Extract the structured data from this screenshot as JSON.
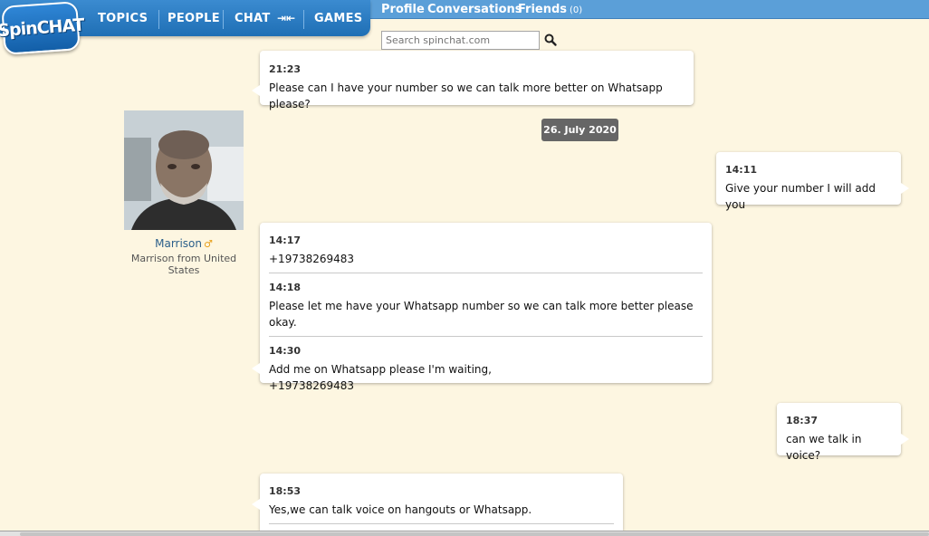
{
  "logo": {
    "text": "SpinCHAT"
  },
  "nav": {
    "topics": "TOPICS",
    "people": "PEOPLE",
    "chat": "CHAT",
    "chat_arrows": "⇥⇤",
    "games": "GAMES"
  },
  "top_links": {
    "profile": "Profile",
    "conversations": "Conversations",
    "friends": "Friends",
    "friends_count": "(0)"
  },
  "search": {
    "placeholder": "Search spinchat.com"
  },
  "profile": {
    "name": "Marrison",
    "gender_symbol": "♂",
    "location": "Marrison from United States"
  },
  "date_separator": "26. July 2020",
  "messages": [
    {
      "side": "left",
      "items": [
        {
          "time": "21:23",
          "text": "Please can I have your number so we can talk more better on Whatsapp please?"
        }
      ]
    },
    {
      "side": "right",
      "items": [
        {
          "time": "14:11",
          "text": "Give your number I will add you"
        }
      ]
    },
    {
      "side": "left",
      "items": [
        {
          "time": "14:17",
          "text": "+19738269483"
        },
        {
          "time": "14:18",
          "text": "Please let me have your Whatsapp number so we can talk more better please okay."
        },
        {
          "time": "14:30",
          "text": "Add me on Whatsapp please I'm waiting,\n+19738269483"
        }
      ]
    },
    {
      "side": "right",
      "items": [
        {
          "time": "18:37",
          "text": "can we talk in voice?"
        }
      ]
    },
    {
      "side": "left",
      "items": [
        {
          "time": "18:53",
          "text": "Yes,we can talk voice on hangouts or Whatsapp."
        }
      ]
    }
  ],
  "colors": {
    "background": "#fdf6e1",
    "nav_blue": "#1f6fb5",
    "topbar_blue": "#5b9fd8",
    "date_badge": "#666666",
    "link_blue": "#2b5f8a"
  }
}
